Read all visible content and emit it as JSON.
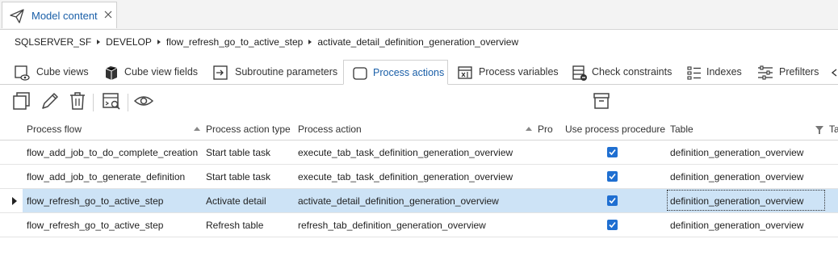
{
  "document_tab": {
    "title": "Model content",
    "icon": "paper-plane-icon",
    "close_icon": "close-icon"
  },
  "breadcrumb": [
    "SQLSERVER_SF",
    "DEVELOP",
    "flow_refresh_go_to_active_step",
    "activate_detail_definition_generation_overview"
  ],
  "sub_tabs": [
    {
      "label": "Cube views",
      "icon": "cube-views-icon",
      "active": false
    },
    {
      "label": "Cube view fields",
      "icon": "cube-icon",
      "active": false
    },
    {
      "label": "Subroutine parameters",
      "icon": "subroutine-icon",
      "active": false
    },
    {
      "label": "Process actions",
      "icon": "rounded-rect-icon",
      "active": true
    },
    {
      "label": "Process variables",
      "icon": "variables-icon",
      "active": false
    },
    {
      "label": "Check constraints",
      "icon": "check-constraints-icon",
      "active": false
    },
    {
      "label": "Indexes",
      "icon": "indexes-icon",
      "active": false
    },
    {
      "label": "Prefilters",
      "icon": "sliders-icon",
      "active": false
    }
  ],
  "toolbar": {
    "buttons": [
      "copy-icon",
      "edit-icon",
      "delete-icon",
      "search-view-icon",
      "eye-icon",
      "archive-icon"
    ]
  },
  "grid": {
    "columns": [
      "Process flow",
      "Process action type",
      "Process action",
      "Pro",
      "Use process procedure",
      "Table",
      "Ta"
    ],
    "rows": [
      {
        "process_flow": "flow_add_job_to_do_complete_creation",
        "action_type": "Start table task",
        "process_action": "execute_tab_task_definition_generation_overview",
        "use_procedure": true,
        "table": "definition_generation_overview",
        "selected": false
      },
      {
        "process_flow": "flow_add_job_to_generate_definition",
        "action_type": "Start table task",
        "process_action": "execute_tab_task_definition_generation_overview",
        "use_procedure": true,
        "table": "definition_generation_overview",
        "selected": false
      },
      {
        "process_flow": "flow_refresh_go_to_active_step",
        "action_type": "Activate detail",
        "process_action": "activate_detail_definition_generation_overview",
        "use_procedure": true,
        "table": "definition_generation_overview",
        "selected": true
      },
      {
        "process_flow": "flow_refresh_go_to_active_step",
        "action_type": "Refresh table",
        "process_action": "refresh_tab_definition_generation_overview",
        "use_procedure": true,
        "table": "definition_generation_overview",
        "selected": false
      }
    ]
  },
  "colors": {
    "accent": "#1a5fa8",
    "selection": "#cde3f6",
    "checkbox": "#1f6fd1"
  }
}
